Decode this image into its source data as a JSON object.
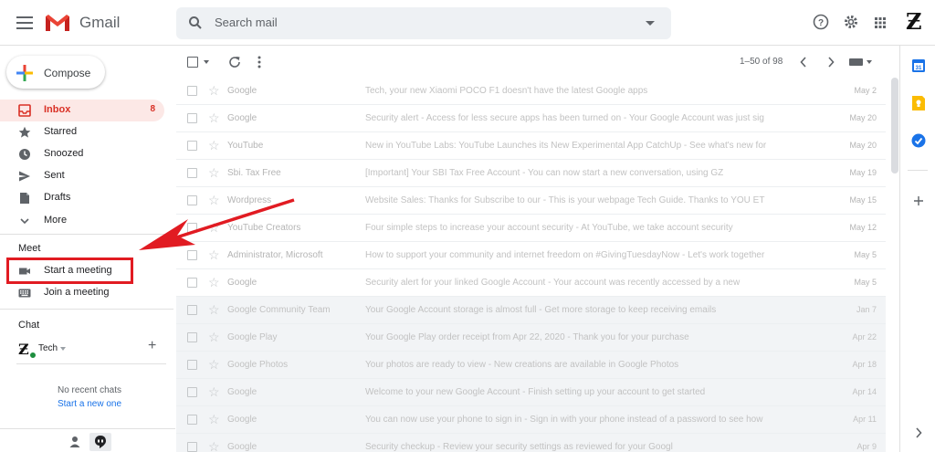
{
  "app": {
    "name": "Gmail",
    "brand_color": "#d93025"
  },
  "search": {
    "placeholder": "Search mail"
  },
  "header_icons": [
    "help-icon",
    "settings-gear-icon",
    "apps-grid-icon",
    "account-avatar-icon"
  ],
  "compose": {
    "label": "Compose"
  },
  "nav": {
    "inbox": {
      "label": "Inbox",
      "count": "8"
    },
    "starred": {
      "label": "Starred"
    },
    "snoozed": {
      "label": "Snoozed"
    },
    "sent": {
      "label": "Sent"
    },
    "drafts": {
      "label": "Drafts"
    },
    "more": {
      "label": "More"
    }
  },
  "meet": {
    "title": "Meet",
    "start": "Start a meeting",
    "join": "Join a meeting"
  },
  "chat": {
    "title": "Chat",
    "user": "Tech",
    "no_recent": "No recent chats",
    "start_new": "Start a new one"
  },
  "toolbar": {
    "pager": "1–50 of 98"
  },
  "emails": [
    {
      "sender": "Google",
      "subject": "Tech, your new Xiaomi POCO F1 doesn't have the latest Google apps",
      "date": "May 2",
      "read": false
    },
    {
      "sender": "Google",
      "subject": "Security alert - Access for less secure apps has been turned on - Your Google Account was just sig",
      "date": "May 20",
      "read": false
    },
    {
      "sender": "YouTube",
      "subject": "New in YouTube Labs: YouTube Launches its New Experimental App CatchUp - See what's new for",
      "date": "May 20",
      "read": false
    },
    {
      "sender": "Sbi. Tax Free",
      "subject": "[Important] Your SBI Tax Free Account - You can now start a new conversation, using GZ",
      "date": "May 19",
      "read": false
    },
    {
      "sender": "Wordpress",
      "subject": "Website Sales: Thanks for Subscribe to our - This is your webpage Tech Guide. Thanks to YOU ET",
      "date": "May 15",
      "read": false
    },
    {
      "sender": "YouTube Creators",
      "subject": "Four simple steps to increase your account security - At YouTube, we take account security",
      "date": "May 12",
      "read": false
    },
    {
      "sender": "Administrator, Microsoft",
      "subject": "How to support your community and internet freedom on #GivingTuesdayNow - Let's work together",
      "date": "May 5",
      "read": false
    },
    {
      "sender": "Google",
      "subject": "Security alert for your linked Google Account - Your account was recently accessed by a new",
      "date": "May 5",
      "read": false
    },
    {
      "sender": "Google Community Team",
      "subject": "Your Google Account storage is almost full - Get more storage to keep receiving emails",
      "date": "Jan 7",
      "read": true
    },
    {
      "sender": "Google Play",
      "subject": "Your Google Play order receipt from Apr 22, 2020 - Thank you for your purchase",
      "date": "Apr 22",
      "read": true
    },
    {
      "sender": "Google Photos",
      "subject": "Your photos are ready to view - New creations are available in Google Photos",
      "date": "Apr 18",
      "read": true
    },
    {
      "sender": "Google",
      "subject": "Welcome to your new Google Account - Finish setting up your account to get started",
      "date": "Apr 14",
      "read": true
    },
    {
      "sender": "Google",
      "subject": "You can now use your phone to sign in - Sign in with your phone instead of a password to see how",
      "date": "Apr 11",
      "read": true
    },
    {
      "sender": "Google",
      "subject": "Security checkup - Review your security settings as reviewed for your Googl",
      "date": "Apr 9",
      "read": true
    }
  ],
  "annotation": {
    "arrow_color": "#e11b22",
    "box_color": "#e11b22"
  }
}
